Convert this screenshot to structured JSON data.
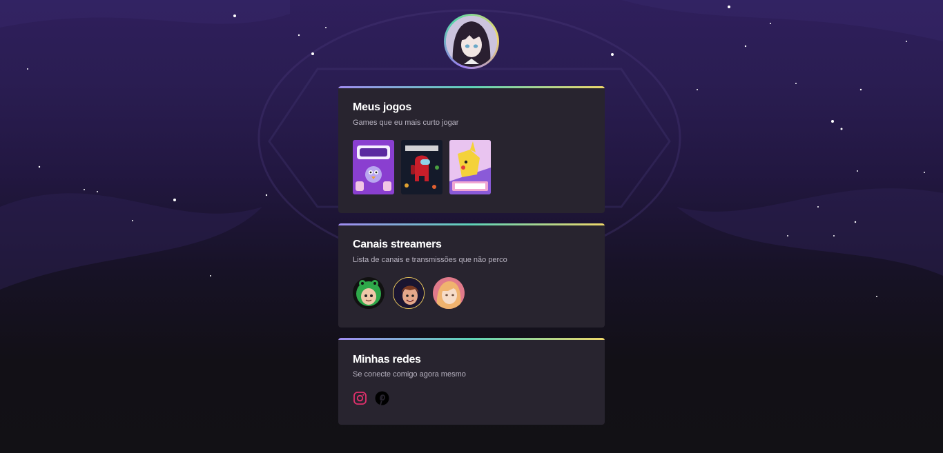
{
  "profile": {
    "avatar_icon": "anime-girl-avatar-icon"
  },
  "sections": {
    "games": {
      "title": "Meus jogos",
      "subtitle": "Games que eu mais curto jogar",
      "items": [
        {
          "icon": "gartic-phone-cover-icon"
        },
        {
          "icon": "among-us-cover-icon"
        },
        {
          "icon": "pokemon-unite-cover-icon"
        }
      ]
    },
    "streamers": {
      "title": "Canais streamers",
      "subtitle": "Lista de canais e transmissões que não perco",
      "items": [
        {
          "icon": "streamer-frog-hood-avatar-icon"
        },
        {
          "icon": "streamer-brown-hair-avatar-icon"
        },
        {
          "icon": "streamer-pink-hair-avatar-icon"
        }
      ]
    },
    "socials": {
      "title": "Minhas redes",
      "subtitle": "Se conecte comigo agora mesmo",
      "items": [
        {
          "icon": "instagram-icon",
          "color": "#e1306c"
        },
        {
          "icon": "pinterest-icon",
          "color": "#000000"
        }
      ]
    }
  },
  "colors": {
    "background_top": "#2f1f5c",
    "background_bottom": "#121115",
    "card": "#28242f",
    "accent_gradient": [
      "#a08cf2",
      "#5ed3b8",
      "#efd86b"
    ]
  }
}
